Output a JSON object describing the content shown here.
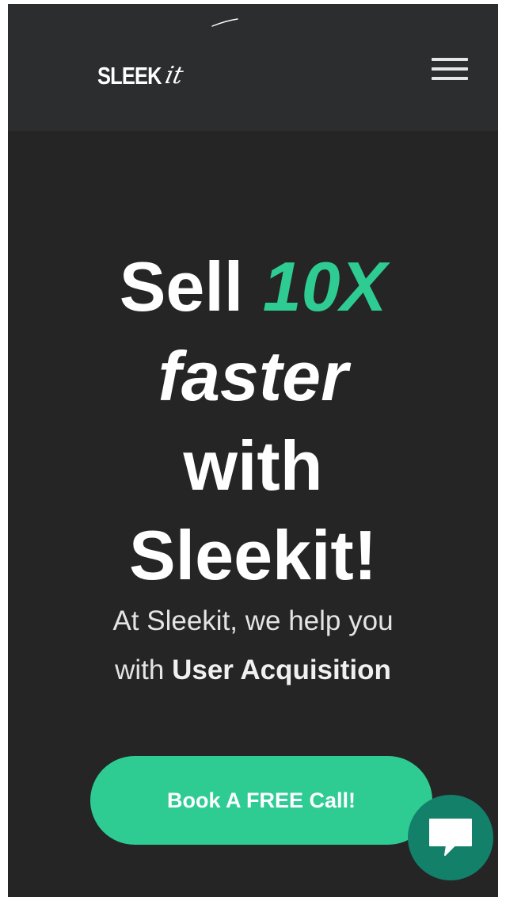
{
  "header": {
    "logo_main": "SLEEK",
    "logo_script": "it",
    "menu_icon": "hamburger-menu-icon"
  },
  "hero": {
    "title_word1": "Sell",
    "title_accent": "10X",
    "title_word2": "faster",
    "title_word3": "with",
    "title_word4": "Sleekit!",
    "subtitle_line1": "At Sleekit, we help you",
    "subtitle_line2_prefix": "with",
    "subtitle_line2_bold": "User Acquisition"
  },
  "cta": {
    "label": "Book A FREE Call!"
  },
  "chat": {
    "icon": "chat-bubble-icon"
  },
  "colors": {
    "background": "#252526",
    "header_background": "#2c2d2e",
    "accent": "#2ecc93",
    "chat_button": "#13806a"
  }
}
